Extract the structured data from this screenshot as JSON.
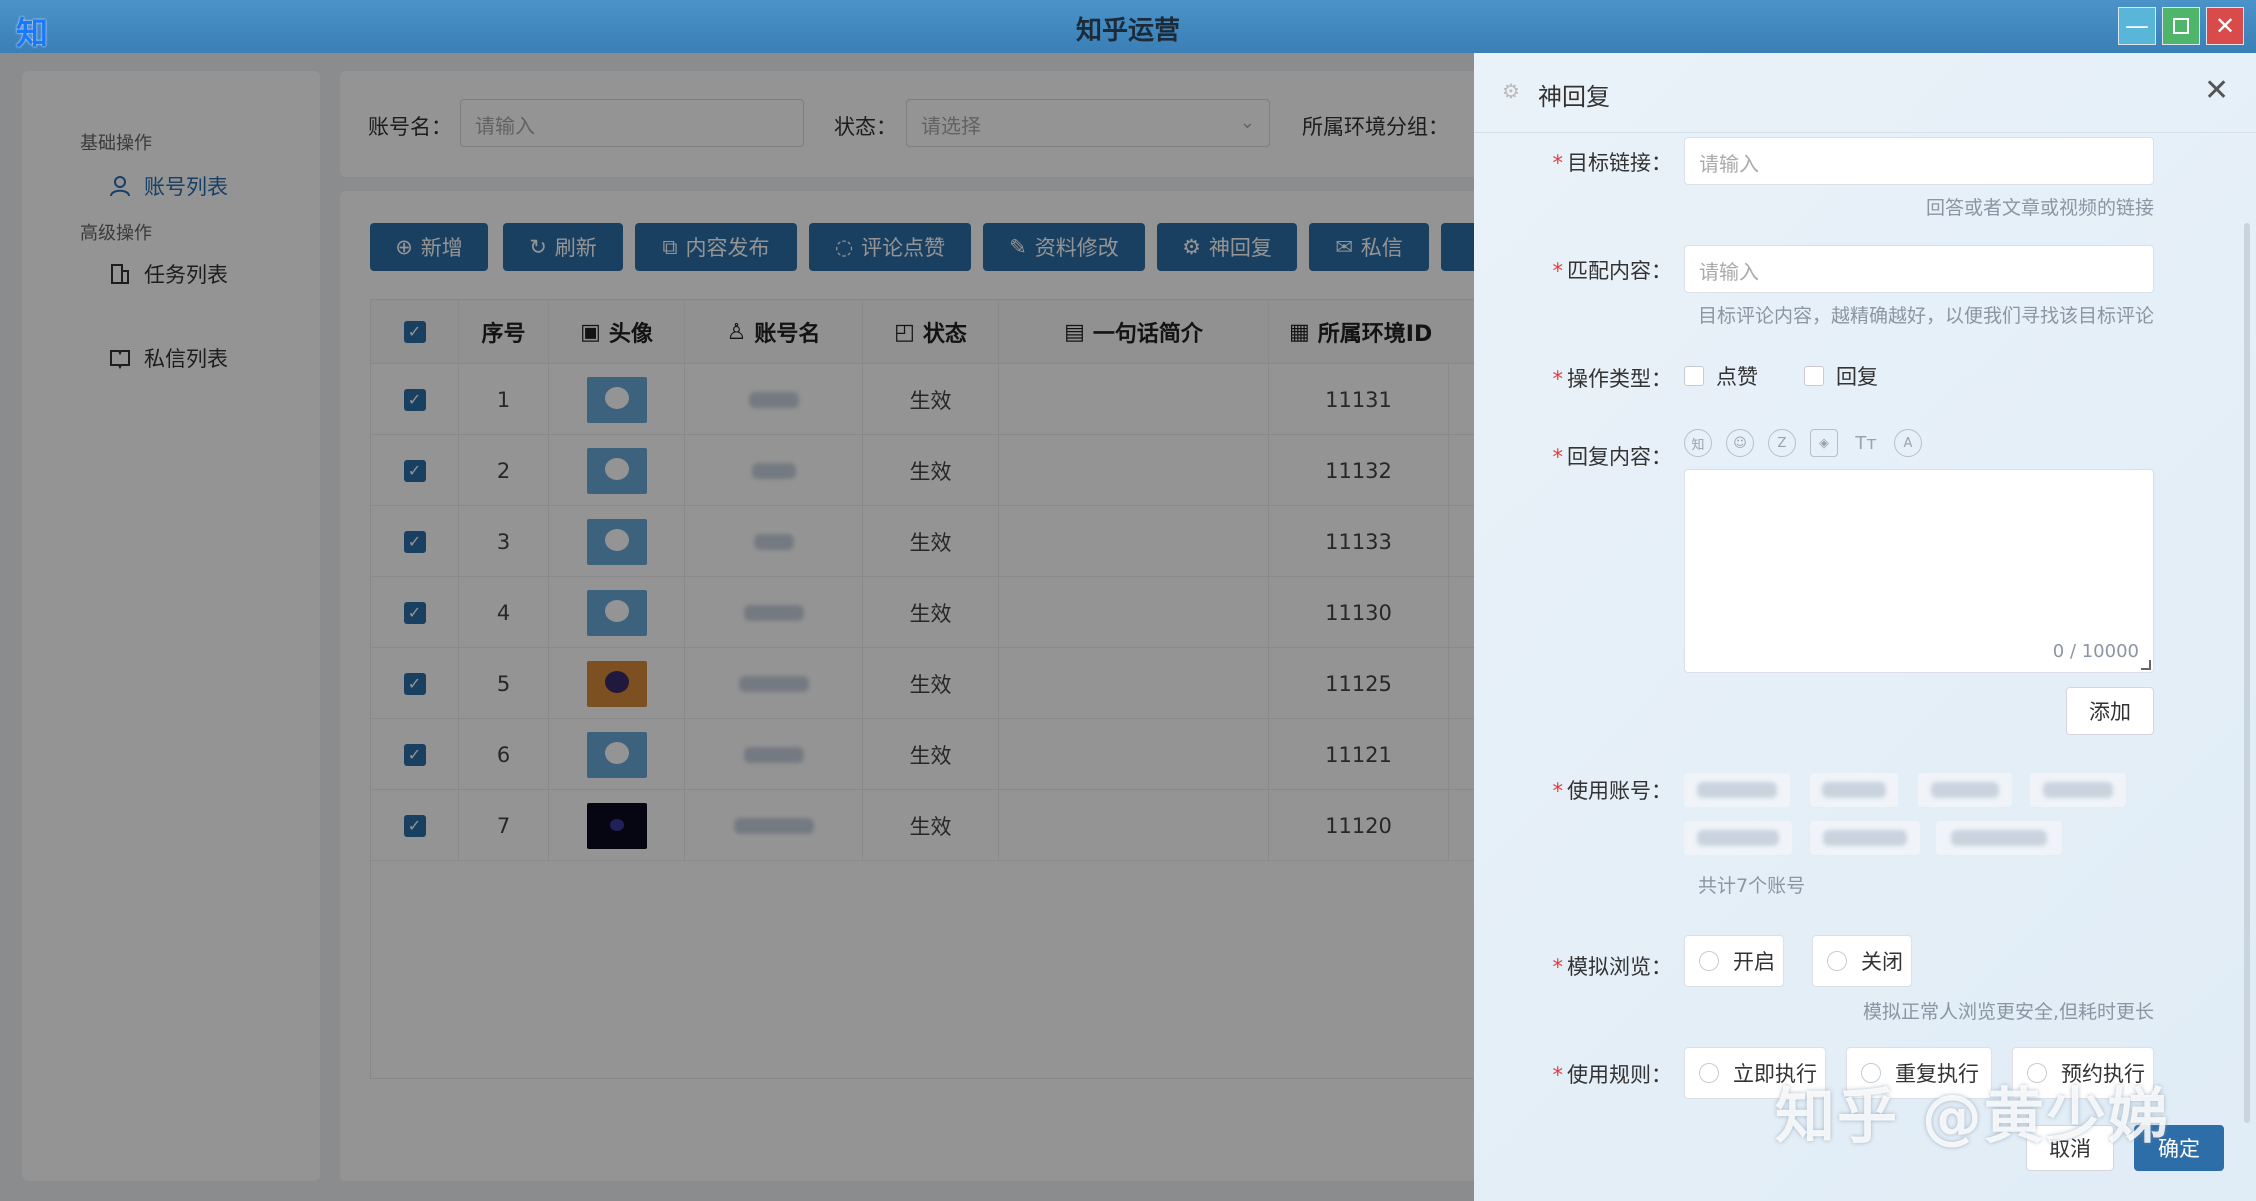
{
  "window": {
    "logo": "知",
    "title": "知乎运营",
    "minimize_icon": "minimize-icon",
    "maximize_icon": "maximize-icon",
    "close_icon": "close-icon"
  },
  "sidebar": {
    "groups": [
      {
        "label": "基础操作",
        "items": [
          {
            "label": "账号列表",
            "icon": "user-icon",
            "active": true
          }
        ]
      },
      {
        "label": "高级操作",
        "items": [
          {
            "label": "任务列表",
            "icon": "building-icon",
            "active": false
          },
          {
            "label": "私信列表",
            "icon": "book-icon",
            "active": false
          }
        ]
      }
    ]
  },
  "filters": {
    "account_label": "账号名：",
    "account_placeholder": "请输入",
    "status_label": "状态：",
    "status_placeholder": "请选择",
    "env_group_label": "所属环境分组："
  },
  "toolbar": {
    "buttons": [
      "新增",
      "刷新",
      "内容发布",
      "评论点赞",
      "资料修改",
      "神回复",
      "私信"
    ]
  },
  "table": {
    "headers": [
      "序号",
      "头像",
      "账号名",
      "状态",
      "一句话简介",
      "所属环境ID"
    ],
    "rows": [
      {
        "index": "1",
        "status": "生效",
        "env_id": "11131"
      },
      {
        "index": "2",
        "status": "生效",
        "env_id": "11132"
      },
      {
        "index": "3",
        "status": "生效",
        "env_id": "11133"
      },
      {
        "index": "4",
        "status": "生效",
        "env_id": "11130"
      },
      {
        "index": "5",
        "status": "生效",
        "env_id": "11125"
      },
      {
        "index": "6",
        "status": "生效",
        "env_id": "11121"
      },
      {
        "index": "7",
        "status": "生效",
        "env_id": "11120"
      }
    ]
  },
  "drawer": {
    "title": "神回复",
    "target_link": {
      "label": "目标链接：",
      "placeholder": "请输入",
      "hint": "回答或者文章或视频的链接"
    },
    "match_content": {
      "label": "匹配内容：",
      "placeholder": "请输入",
      "hint": "目标评论内容，越精确越好，以便我们寻找该目标评论"
    },
    "op_type": {
      "label": "操作类型：",
      "options": [
        "点赞",
        "回复"
      ]
    },
    "reply_content": {
      "label": "回复内容：",
      "char_count": "0 / 10000",
      "toolbar_icons": [
        "zhihu-icon",
        "emoji-icon",
        "z-icon",
        "cube-icon",
        "text-size-icon",
        "at-icon"
      ]
    },
    "add_button": "添加",
    "use_account": {
      "label": "使用账号：",
      "total": "共计7个账号"
    },
    "simulate_browse": {
      "label": "模拟浏览：",
      "options": [
        "开启",
        "关闭"
      ],
      "hint": "模拟正常人浏览更安全,但耗时更长"
    },
    "use_rule": {
      "label": "使用规则：",
      "options": [
        "立即执行",
        "重复执行",
        "预约执行"
      ]
    },
    "cancel": "取消",
    "confirm": "确定"
  },
  "watermark": "知乎 @黄少娣"
}
